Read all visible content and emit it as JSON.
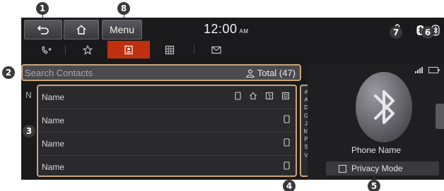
{
  "topbar": {
    "menu_label": "Menu",
    "time": "12:00",
    "ampm": "AM",
    "icons": [
      "back-icon",
      "home-icon",
      "microphone-icon",
      "bluetooth-switch-icon"
    ]
  },
  "tabs": [
    {
      "icon": "call-history-icon",
      "active": false
    },
    {
      "icon": "favorites-star-icon",
      "active": false
    },
    {
      "icon": "contacts-icon",
      "active": true
    },
    {
      "icon": "keypad-icon",
      "active": false
    },
    {
      "icon": "messages-icon",
      "active": false
    }
  ],
  "search": {
    "placeholder": "Search Contacts",
    "total_label": "Total (47)"
  },
  "contacts": {
    "index_letter": "N",
    "rows": [
      {
        "name": "Name"
      },
      {
        "name": "Name"
      },
      {
        "name": "Name"
      },
      {
        "name": "Name"
      }
    ]
  },
  "alphabet": [
    "#",
    "A",
    "D",
    "G",
    "J",
    "M",
    "P",
    "S",
    "V"
  ],
  "device": {
    "phone_name": "Phone Name",
    "privacy_label": "Privacy Mode"
  },
  "callouts": [
    "1",
    "2",
    "3",
    "4",
    "5",
    "6",
    "7",
    "8"
  ],
  "colors": {
    "accent": "#c0300f",
    "highlight_border": "#c9a47a",
    "background": "#1a1a1c"
  }
}
